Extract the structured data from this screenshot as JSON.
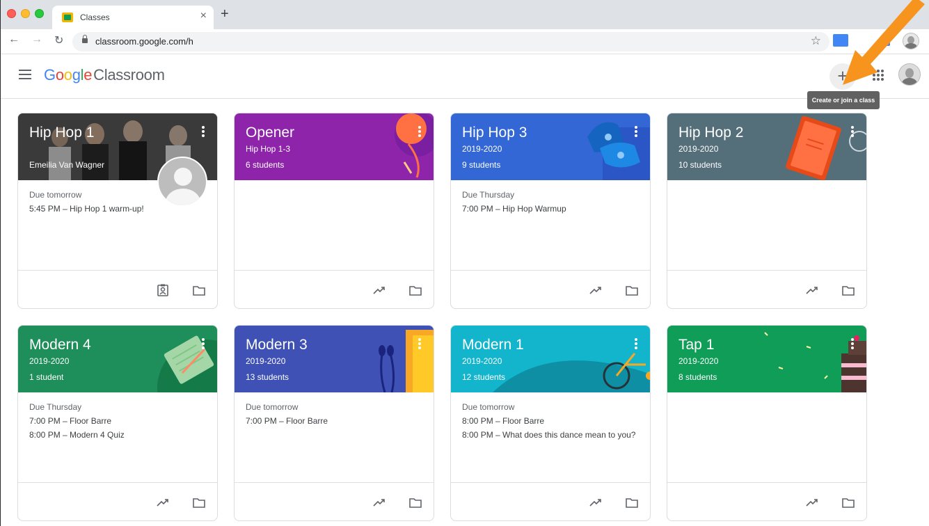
{
  "browser": {
    "tab_title": "Classes",
    "url": "classroom.google.com/h",
    "tab_close": "×",
    "new_tab": "+"
  },
  "app": {
    "brand_google": [
      "G",
      "o",
      "o",
      "g",
      "l",
      "e"
    ],
    "brand_product": "Classroom",
    "create_tooltip": "Create or join a class",
    "plus_label": "+"
  },
  "colors": {
    "hiphop1": "#4b4b4b",
    "opener": "#8e24aa",
    "hiphop3": "#3367d6",
    "hiphop2": "#546e7a",
    "modern4": "#1e8e5a",
    "modern3": "#3f51b5",
    "modern1": "#12b5cb",
    "tap1": "#0f9d58"
  },
  "cards": [
    {
      "title": "Hip Hop 1",
      "subtitle": "",
      "count": "",
      "teacher": "Emeilia Van Wagner",
      "due": "Due tomorrow",
      "items": [
        "5:45 PM – Hip Hop 1 warm-up!"
      ]
    },
    {
      "title": "Opener",
      "subtitle": "Hip Hop 1-3",
      "count": "6 students",
      "due": "",
      "items": []
    },
    {
      "title": "Hip Hop 3",
      "subtitle": "2019-2020",
      "count": "9 students",
      "due": "Due Thursday",
      "items": [
        "7:00 PM – Hip Hop Warmup"
      ]
    },
    {
      "title": "Hip Hop 2",
      "subtitle": "2019-2020",
      "count": "10 students",
      "due": "",
      "items": []
    },
    {
      "title": "Modern 4",
      "subtitle": "2019-2020",
      "count": "1 student",
      "due": "Due Thursday",
      "items": [
        "7:00 PM – Floor Barre",
        "8:00 PM – Modern 4 Quiz"
      ]
    },
    {
      "title": "Modern 3",
      "subtitle": "2019-2020",
      "count": "13 students",
      "due": "Due tomorrow",
      "items": [
        "7:00 PM – Floor Barre"
      ]
    },
    {
      "title": "Modern 1",
      "subtitle": "2019-2020",
      "count": "12 students",
      "due": "Due tomorrow",
      "items": [
        "8:00 PM – Floor Barre",
        "8:00 PM – What does this dance mean to you?"
      ]
    },
    {
      "title": "Tap 1",
      "subtitle": "2019-2020",
      "count": "8 students",
      "due": "",
      "items": []
    }
  ]
}
